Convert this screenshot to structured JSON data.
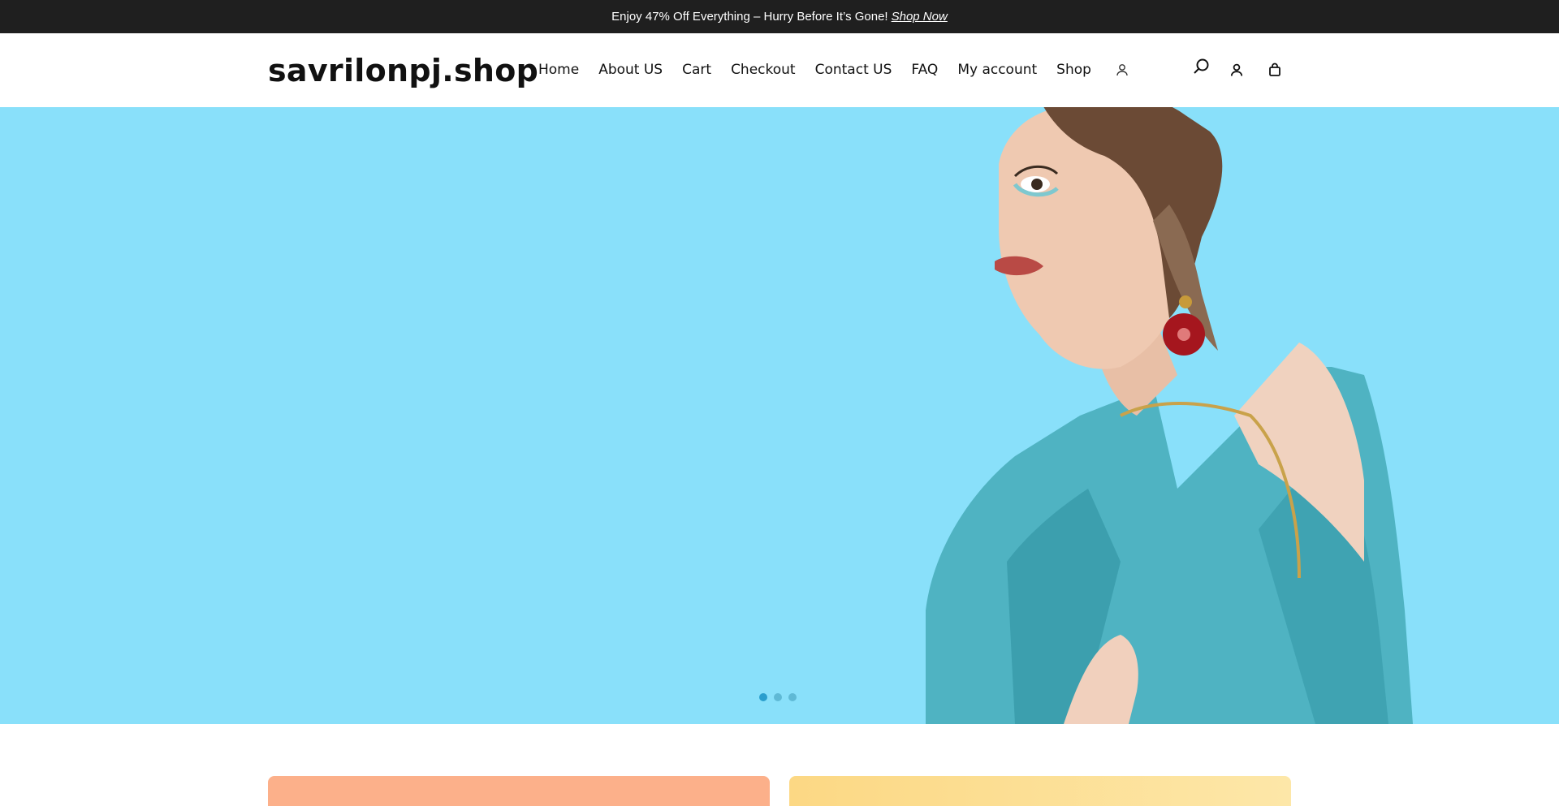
{
  "announcement": {
    "text": "Enjoy 47% Off Everything – Hurry Before It’s Gone!",
    "link": "Shop Now"
  },
  "header": {
    "logo": "savrilonpj.shop",
    "nav": [
      "Home",
      "About US",
      "Cart",
      "Checkout",
      "Contact US",
      "FAQ",
      "My account",
      "Shop"
    ],
    "icons": [
      "account-icon",
      "search-icon",
      "user-icon",
      "cart-bag-icon"
    ]
  },
  "hero": {
    "background": "#89e0fa",
    "slides": 3,
    "active_slide": 1
  },
  "promo_cards": [
    {
      "color": "#fcb08a"
    },
    {
      "color": "#fcd884"
    }
  ]
}
